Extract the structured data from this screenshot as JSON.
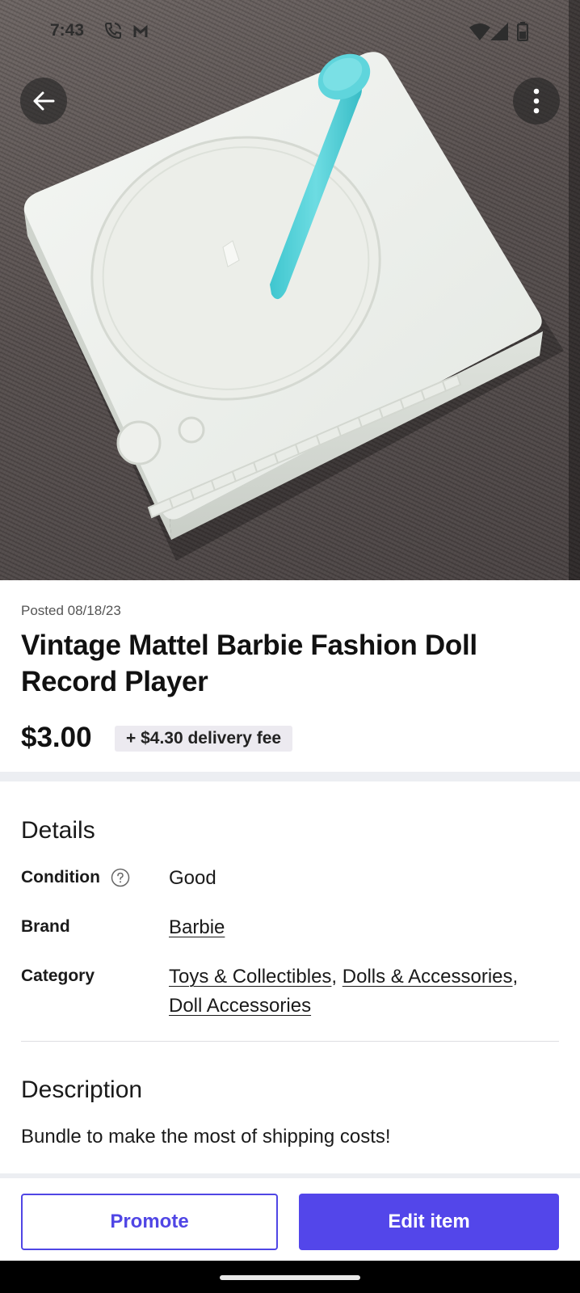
{
  "status_bar": {
    "time": "7:43",
    "icons": [
      "phone-call-icon",
      "gmail-icon",
      "wifi-icon",
      "cell-signal-icon",
      "battery-icon"
    ]
  },
  "hero": {
    "image": "white toy record player with turquoise tone arm on grey fabric",
    "back_icon": "back-arrow-icon",
    "more_icon": "more-vertical-icon"
  },
  "listing": {
    "posted": "Posted 08/18/23",
    "title": "Vintage Mattel Barbie Fashion Doll Record Player",
    "price": "$3.00",
    "delivery_fee": "+ $4.30 delivery fee"
  },
  "details": {
    "heading": "Details",
    "condition_label": "Condition",
    "condition_value": "Good",
    "brand_label": "Brand",
    "brand_value": "Barbie",
    "category_label": "Category",
    "categories": [
      "Toys & Collectibles",
      "Dolls & Accessories",
      "Doll Accessories"
    ],
    "separator": ","
  },
  "description": {
    "heading": "Description",
    "text": "Bundle to make the most of shipping costs!"
  },
  "actions": {
    "promote_label": "Promote",
    "edit_label": "Edit item"
  },
  "colors": {
    "accent": "#5346ea",
    "divider": "#eceef2",
    "chip_bg": "#eceaf0"
  }
}
